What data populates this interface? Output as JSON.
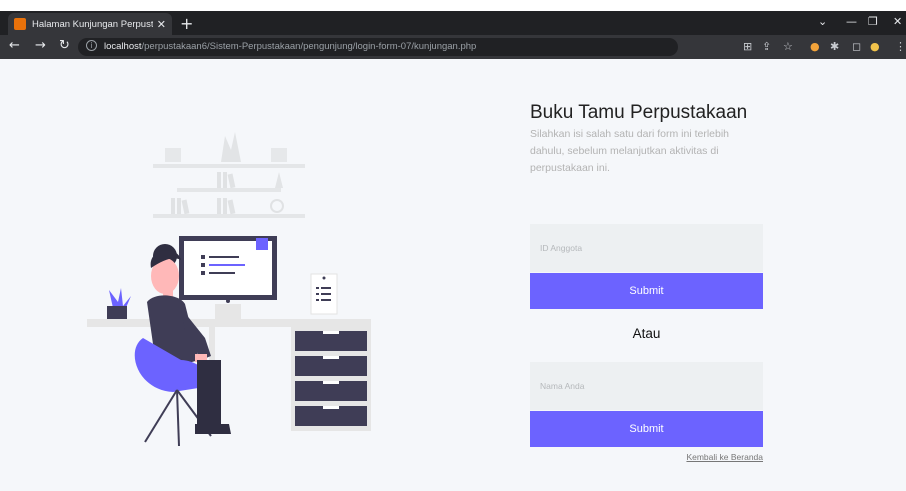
{
  "browser": {
    "tab_title": "Halaman Kunjungan Perpustakaa",
    "new_tab_icon": "+",
    "url_host": "localhost",
    "url_path": "/perpustakaan6/Sistem-Perpustakaan/pengunjung/login-form-07/kunjungan.php"
  },
  "form": {
    "title": "Buku Tamu Perpustakaan",
    "subtitle": "Silahkan isi salah satu dari form ini terlebih dahulu, sebelum melanjutkan aktivitas di perpustakaan ini.",
    "id_placeholder": "ID Anggota",
    "submit_label_1": "Submit",
    "or_label": "Atau",
    "name_placeholder": "Nama Anda",
    "submit_label_2": "Submit",
    "back_link": "Kembali ke Beranda"
  },
  "colors": {
    "accent": "#6c63ff",
    "page_bg": "#f5f7fa",
    "input_bg": "#edf0f2"
  }
}
